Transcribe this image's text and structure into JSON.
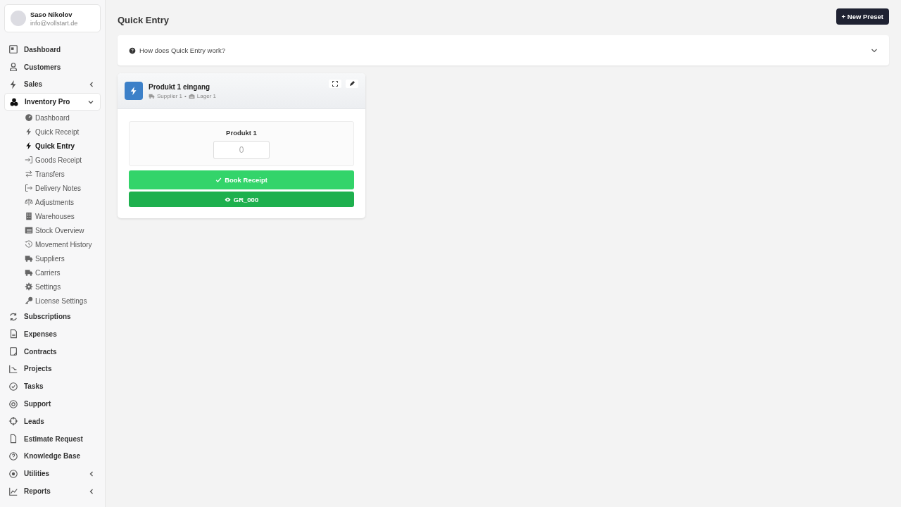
{
  "user": {
    "name": "Saso Nikolov",
    "email": "info@vollstart.de"
  },
  "sidebar": {
    "items": [
      {
        "label": "Dashboard",
        "kind": "link",
        "selected": false
      },
      {
        "label": "Customers",
        "kind": "link",
        "selected": false
      },
      {
        "label": "Sales",
        "kind": "group",
        "expanded": false,
        "selected": false
      },
      {
        "label": "Inventory Pro",
        "kind": "group",
        "expanded": true,
        "selected": true,
        "children": [
          {
            "label": "Dashboard",
            "selected": false
          },
          {
            "label": "Quick Receipt",
            "selected": false
          },
          {
            "label": "Quick Entry",
            "selected": true
          },
          {
            "label": "Goods Receipt",
            "selected": false
          },
          {
            "label": "Transfers",
            "selected": false
          },
          {
            "label": "Delivery Notes",
            "selected": false
          },
          {
            "label": "Adjustments",
            "selected": false
          },
          {
            "label": "Warehouses",
            "selected": false
          },
          {
            "label": "Stock Overview",
            "selected": false
          },
          {
            "label": "Movement History",
            "selected": false
          },
          {
            "label": "Suppliers",
            "selected": false
          },
          {
            "label": "Carriers",
            "selected": false
          },
          {
            "label": "Settings",
            "selected": false
          },
          {
            "label": "License Settings",
            "selected": false
          }
        ]
      },
      {
        "label": "Subscriptions",
        "kind": "link",
        "selected": false
      },
      {
        "label": "Expenses",
        "kind": "link",
        "selected": false
      },
      {
        "label": "Contracts",
        "kind": "link",
        "selected": false
      },
      {
        "label": "Projects",
        "kind": "link",
        "selected": false
      },
      {
        "label": "Tasks",
        "kind": "link",
        "selected": false
      },
      {
        "label": "Support",
        "kind": "link",
        "selected": false
      },
      {
        "label": "Leads",
        "kind": "link",
        "selected": false
      },
      {
        "label": "Estimate Request",
        "kind": "link",
        "selected": false
      },
      {
        "label": "Knowledge Base",
        "kind": "link",
        "selected": false
      },
      {
        "label": "Utilities",
        "kind": "group",
        "expanded": false,
        "selected": false
      },
      {
        "label": "Reports",
        "kind": "group",
        "expanded": false,
        "selected": false
      }
    ]
  },
  "page": {
    "title": "Quick Entry",
    "new_button": "+ New Preset"
  },
  "help": {
    "question": "How does Quick Entry work?",
    "expanded": false
  },
  "preset": {
    "title": "Produkt 1 eingang",
    "supplier": "Supplier 1",
    "separator": "•",
    "warehouse": "Lager 1",
    "product": {
      "name": "Produkt 1",
      "placeholder": "0"
    },
    "book_button": "Book Receipt",
    "receipt_button": "GR_000"
  }
}
